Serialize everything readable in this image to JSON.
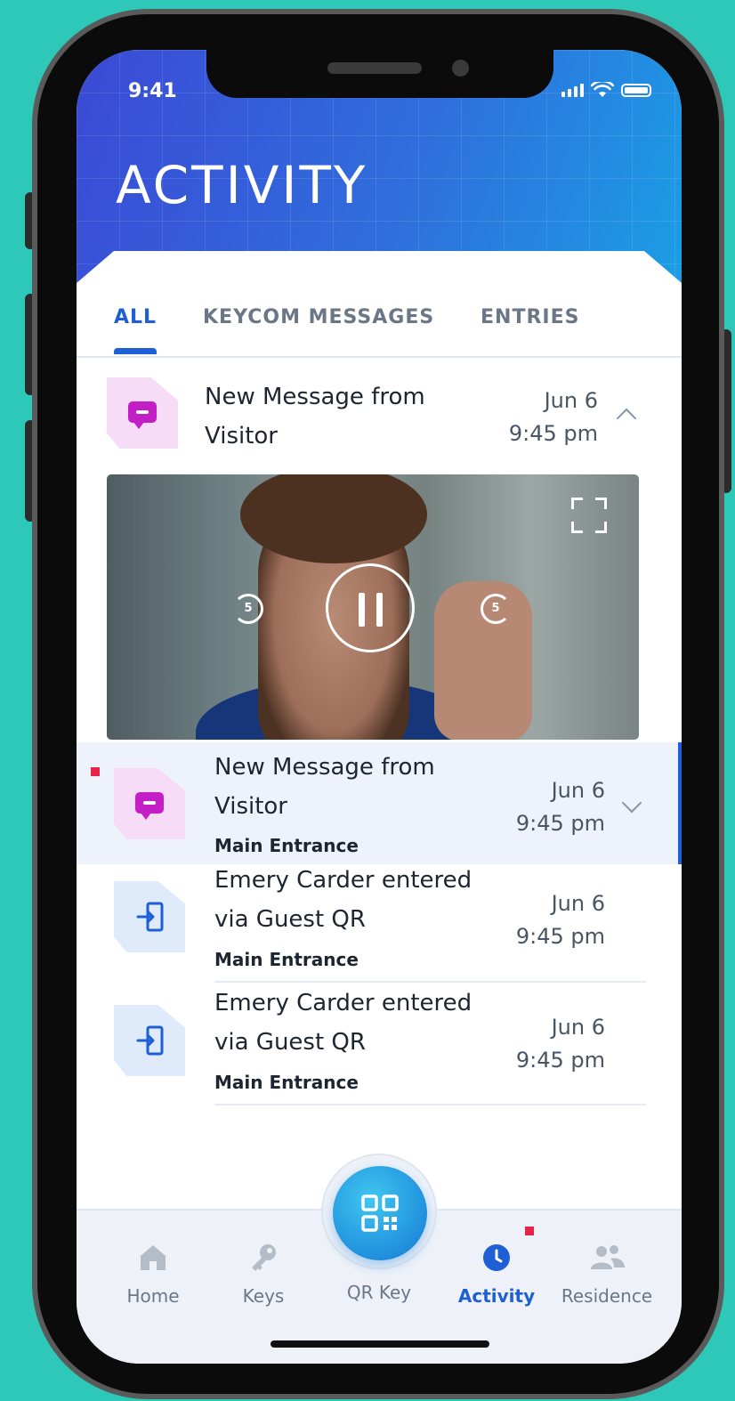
{
  "status_bar": {
    "time": "9:41"
  },
  "header": {
    "title": "ACTIVITY"
  },
  "tabs": [
    {
      "label": "ALL",
      "active": true
    },
    {
      "label": "KEYCOM MESSAGES",
      "active": false
    },
    {
      "label": "ENTRIES",
      "active": false
    }
  ],
  "expanded_item": {
    "title_line1": "New Message from",
    "title_line2": "Visitor",
    "date": "Jun 6",
    "time": "9:45 pm",
    "icon": "message-icon",
    "video": {
      "skip_back_label": "5",
      "skip_forward_label": "5"
    }
  },
  "list": [
    {
      "title_line1": "New Message from",
      "title_line2": "Visitor",
      "subtitle": "Main Entrance",
      "date": "Jun 6",
      "time": "9:45 pm",
      "icon": "message-icon",
      "unread": true,
      "highlighted": true
    },
    {
      "title_line1": "Emery Carder entered",
      "title_line2": "via Guest QR",
      "subtitle": "Main Entrance",
      "date": "Jun 6",
      "time": "9:45 pm",
      "icon": "entry-icon"
    },
    {
      "title_line1": "Emery Carder entered",
      "title_line2": "via Guest QR",
      "subtitle": "Main Entrance",
      "date": "Jun 6",
      "time": "9:45 pm",
      "icon": "entry-icon"
    }
  ],
  "bottom_nav": [
    {
      "label": "Home",
      "icon": "home-icon"
    },
    {
      "label": "Keys",
      "icon": "key-icon"
    },
    {
      "label": "QR Key",
      "icon": "qr-icon"
    },
    {
      "label": "Activity",
      "icon": "clock-icon",
      "active": true,
      "badge": true
    },
    {
      "label": "Residence",
      "icon": "people-icon"
    }
  ],
  "colors": {
    "accent": "#1f5fd6",
    "message": "#c41fc6",
    "unread": "#e8234a",
    "background": "#2ec8b8"
  }
}
